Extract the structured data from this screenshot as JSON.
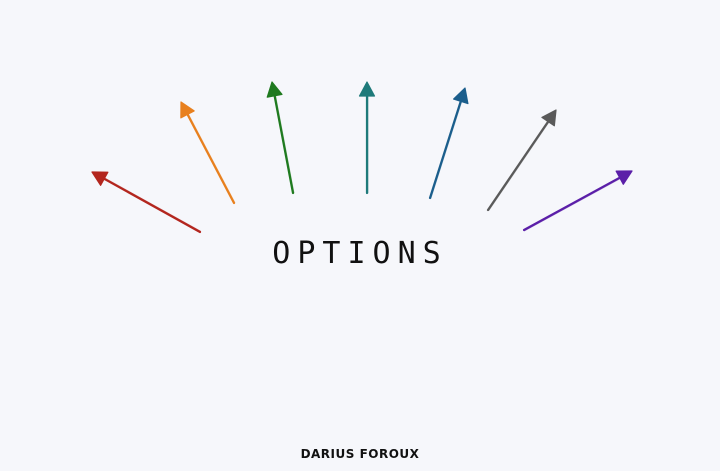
{
  "diagram": {
    "title": "OPTIONS",
    "signature": "DARIUS FOROUX",
    "arrows": [
      {
        "id": "red",
        "color": "#b3261e"
      },
      {
        "id": "orange",
        "color": "#e8801e"
      },
      {
        "id": "green",
        "color": "#1f7a1f"
      },
      {
        "id": "teal",
        "color": "#1e7a7a"
      },
      {
        "id": "blue",
        "color": "#1b5e8c"
      },
      {
        "id": "gray",
        "color": "#5a5a5a"
      },
      {
        "id": "purple",
        "color": "#5b1fa8"
      }
    ]
  }
}
